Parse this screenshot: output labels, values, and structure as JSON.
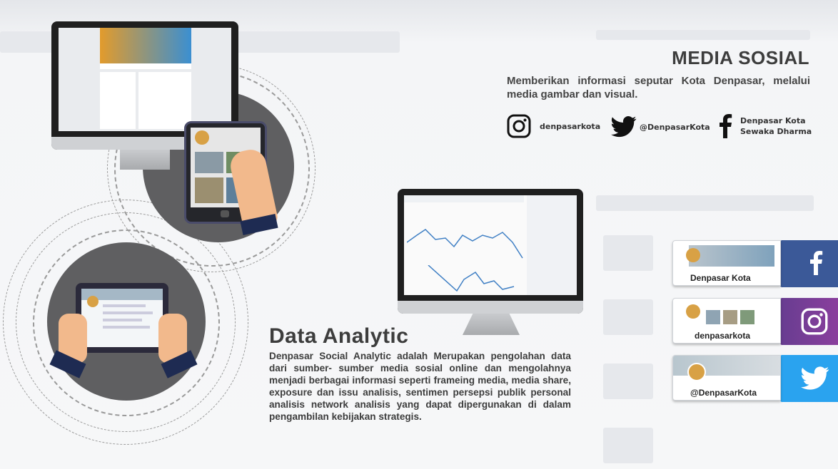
{
  "media_sosial": {
    "title": "MEDIA SOSIAL",
    "description": "Memberikan informasi seputar Kota Denpasar, melalui media gambar dan visual.",
    "instagram_handle": "denpasarkota",
    "twitter_handle": "@DenpasarKota",
    "facebook_line1": "Denpasar Kota",
    "facebook_line2": "Sewaka Dharma"
  },
  "data_analytic": {
    "title": "Data Analytic",
    "description": "Denpasar Social Analytic adalah Merupakan pengolahan data dari sumber- sumber media sosial online dan mengolahnya menjadi berbagai informasi seperti frameing media, media share, exposure dan issu analisis, sentimen persepsi publik personal analisis network analisis yang dapat dipergunakan di dalam pengambilan kebijakan strategis."
  },
  "banners": [
    {
      "label": "Denpasar Kota",
      "icon": "facebook-icon",
      "color": "#3b5998"
    },
    {
      "label": "denpasarkota",
      "icon": "instagram-icon",
      "color": "#7a3f9a"
    },
    {
      "label": "@DenpasarKota",
      "icon": "twitter-icon",
      "color": "#2aa3ef"
    }
  ],
  "colors": {
    "circle_gray": "#5f5f61",
    "facebook": "#3b5998",
    "twitter": "#2aa3ef",
    "instagram": "#7a3f9a"
  }
}
